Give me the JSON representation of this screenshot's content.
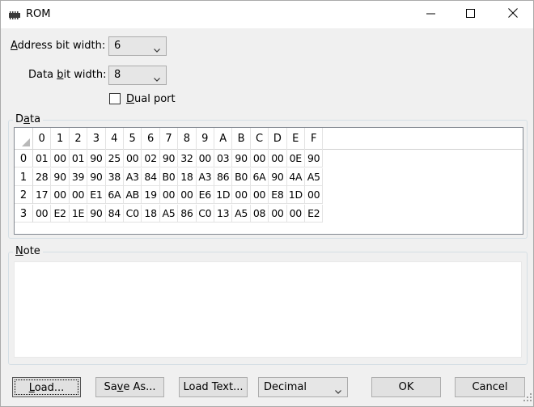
{
  "window": {
    "title": "ROM",
    "minimize_icon": "minimize-icon",
    "maximize_icon": "maximize-icon",
    "close_icon": "close-icon"
  },
  "form": {
    "address_label_prefix": "",
    "address_label_mnemonic": "A",
    "address_label_rest": "ddress bit width:",
    "address_value": "6",
    "data_label_prefix": "Data ",
    "data_label_mnemonic": "b",
    "data_label_rest": "it width:",
    "data_value": "8",
    "dual_port_mnemonic": "D",
    "dual_port_rest": "ual port",
    "dual_port_checked": false
  },
  "data_group": {
    "label_prefix": "D",
    "label_mnemonic": "a",
    "label_rest": "ta",
    "columns": [
      "0",
      "1",
      "2",
      "3",
      "4",
      "5",
      "6",
      "7",
      "8",
      "9",
      "A",
      "B",
      "C",
      "D",
      "E",
      "F"
    ],
    "rows": [
      {
        "label": "0",
        "cells": [
          "01",
          "00",
          "01",
          "90",
          "25",
          "00",
          "02",
          "90",
          "32",
          "00",
          "03",
          "90",
          "00",
          "00",
          "0E",
          "90"
        ]
      },
      {
        "label": "1",
        "cells": [
          "28",
          "90",
          "39",
          "90",
          "38",
          "A3",
          "84",
          "B0",
          "18",
          "A3",
          "86",
          "B0",
          "6A",
          "90",
          "4A",
          "A5"
        ]
      },
      {
        "label": "2",
        "cells": [
          "17",
          "00",
          "00",
          "E1",
          "6A",
          "AB",
          "19",
          "00",
          "00",
          "E6",
          "1D",
          "00",
          "00",
          "E8",
          "1D",
          "00"
        ]
      },
      {
        "label": "3",
        "cells": [
          "00",
          "E2",
          "1E",
          "90",
          "84",
          "C0",
          "18",
          "A5",
          "86",
          "C0",
          "13",
          "A5",
          "08",
          "00",
          "00",
          "E2"
        ]
      }
    ]
  },
  "note_group": {
    "label_mnemonic": "N",
    "label_rest": "ote",
    "text": ""
  },
  "buttons": {
    "load_mnemonic": "L",
    "load_rest": "oad...",
    "save_prefix": "Sa",
    "save_mnemonic": "v",
    "save_rest": "e As...",
    "load_text": "Load Text...",
    "format_value": "Decimal",
    "ok": "OK",
    "cancel": "Cancel"
  },
  "colors": {
    "window_bg": "#f0f0f0",
    "titlebar_bg": "#ffffff",
    "button_bg": "#e1e1e1",
    "combo_bg": "#e6e6e6"
  }
}
